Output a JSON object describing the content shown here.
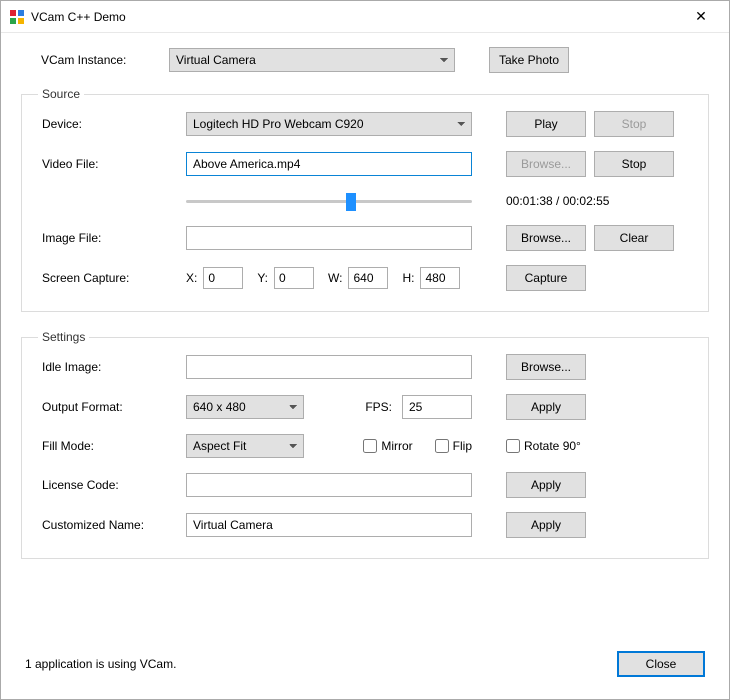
{
  "title": "VCam C++ Demo",
  "instance": {
    "label": "VCam Instance:",
    "value": "Virtual Camera",
    "takePhoto": "Take Photo"
  },
  "source": {
    "legend": "Source",
    "device": {
      "label": "Device:",
      "value": "Logitech HD Pro Webcam C920",
      "play": "Play",
      "stop": "Stop"
    },
    "videoFile": {
      "label": "Video File:",
      "value": "Above America.mp4",
      "browse": "Browse...",
      "stop": "Stop",
      "time": "00:01:38 / 00:02:55"
    },
    "imageFile": {
      "label": "Image File:",
      "value": "",
      "browse": "Browse...",
      "clear": "Clear"
    },
    "screenCap": {
      "label": "Screen Capture:",
      "xl": "X:",
      "x": "0",
      "yl": "Y:",
      "y": "0",
      "wl": "W:",
      "w": "640",
      "hl": "H:",
      "h": "480",
      "capture": "Capture"
    }
  },
  "settings": {
    "legend": "Settings",
    "idle": {
      "label": "Idle Image:",
      "value": "",
      "browse": "Browse..."
    },
    "outfmt": {
      "label": "Output Format:",
      "value": "640 x 480",
      "fpsLabel": "FPS:",
      "fps": "25",
      "apply": "Apply"
    },
    "fill": {
      "label": "Fill Mode:",
      "value": "Aspect Fit",
      "mirror": "Mirror",
      "flip": "Flip",
      "rotate": "Rotate 90°"
    },
    "license": {
      "label": "License Code:",
      "value": "",
      "apply": "Apply"
    },
    "custom": {
      "label": "Customized Name:",
      "value": "Virtual Camera",
      "apply": "Apply"
    }
  },
  "status": "1 application is using VCam.",
  "closeBtn": "Close"
}
